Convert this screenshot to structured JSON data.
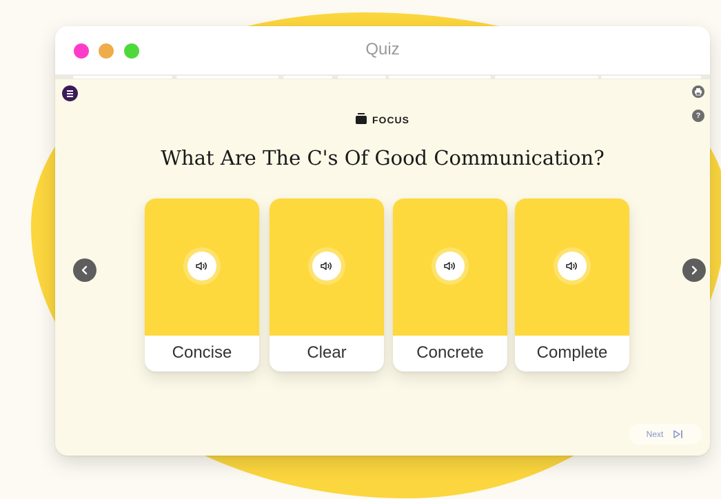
{
  "window": {
    "title": "Quiz",
    "traffic_lights": [
      "#ff3cc8",
      "#f0ac4a",
      "#4fd83c"
    ]
  },
  "header": {
    "section_label": "FOCUS",
    "section_icon": "chest-icon"
  },
  "question": "What Are The C's Of Good Communication?",
  "cards": [
    {
      "label": "Concise",
      "icon": "speaker-icon"
    },
    {
      "label": "Clear",
      "icon": "speaker-icon"
    },
    {
      "label": "Concrete",
      "icon": "speaker-icon"
    },
    {
      "label": "Complete",
      "icon": "speaker-icon"
    }
  ],
  "footer": {
    "next_label": "Next",
    "next_icon": "skip-next-icon"
  },
  "colors": {
    "accent_yellow": "#fdd93d",
    "menu_purple": "#3b1a5a",
    "next_blue": "#8a93c9"
  }
}
